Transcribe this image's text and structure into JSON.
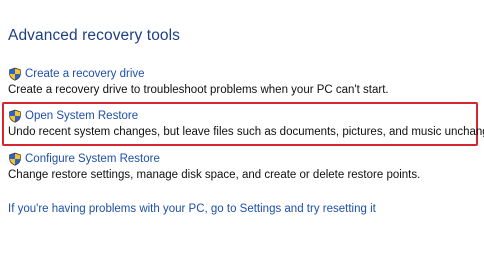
{
  "section": {
    "heading": "Advanced recovery tools"
  },
  "tools": [
    {
      "label": "Create a recovery drive",
      "description": "Create a recovery drive to troubleshoot problems when your PC can't start.",
      "icon": "uac-shield-icon"
    },
    {
      "label": "Open System Restore",
      "description": "Undo recent system changes, but leave files such as documents, pictures, and music unchanged.",
      "icon": "uac-shield-icon",
      "highlighted": true
    },
    {
      "label": "Configure System Restore",
      "description": "Change restore settings, manage disk space, and create or delete restore points.",
      "icon": "uac-shield-icon"
    }
  ],
  "footer": {
    "reset_link": "If you're having problems with your PC, go to Settings and try resetting it"
  },
  "colors": {
    "heading": "#1e3f84",
    "link": "#1e4fa8",
    "highlight_border": "#d7262f"
  }
}
